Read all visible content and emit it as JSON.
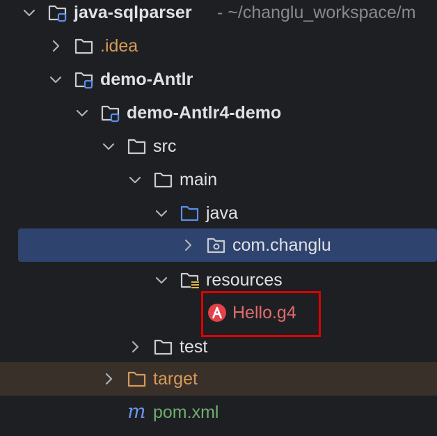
{
  "tree": {
    "root": {
      "label": "java-sqlparser",
      "suffix": "- ~/changlu_workspace/m"
    },
    "idea": {
      "label": ".idea"
    },
    "demo_antlr": {
      "label": "demo-Antlr"
    },
    "demo_antlr4_demo": {
      "label": "demo-Antlr4-demo"
    },
    "src": {
      "label": "src"
    },
    "main": {
      "label": "main"
    },
    "java": {
      "label": "java"
    },
    "package": {
      "label": "com.changlu"
    },
    "resources": {
      "label": "resources"
    },
    "hello": {
      "label": "Hello.g4"
    },
    "test": {
      "label": "test"
    },
    "target": {
      "label": "target"
    },
    "pom": {
      "label": "pom.xml"
    }
  },
  "colors": {
    "background": "#1e1f22",
    "selection": "#2e436e",
    "text": "#dfe1e5",
    "idea_text": "#d69a5b",
    "target_text": "#d69a5b",
    "pom_text": "#6fae6f",
    "hello_text": "#e06c6c",
    "highlight_border": "#e00000"
  }
}
